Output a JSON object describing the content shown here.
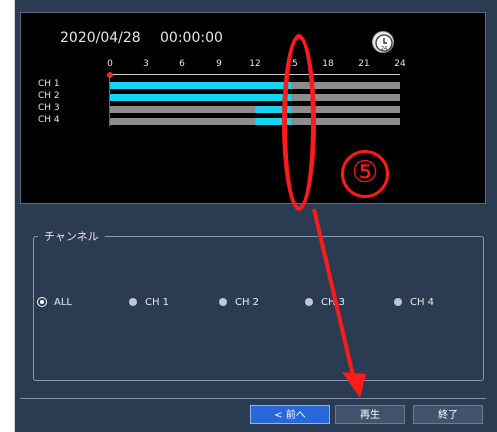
{
  "timeline": {
    "date": "2020/04/28",
    "time": "00:00:00",
    "ticks": [
      "0",
      "3",
      "6",
      "9",
      "12",
      "15",
      "18",
      "21",
      "24"
    ],
    "channels": [
      {
        "label": "CH 1",
        "segments": [
          [
            0,
            15
          ]
        ]
      },
      {
        "label": "CH 2",
        "segments": [
          [
            0,
            15
          ]
        ]
      },
      {
        "label": "CH 3",
        "segments": [
          [
            12,
            15
          ]
        ]
      },
      {
        "label": "CH 4",
        "segments": [
          [
            12,
            15
          ]
        ]
      }
    ],
    "clock_icon_label": "24"
  },
  "channel_panel": {
    "title": "チャンネル",
    "options": [
      "ALL",
      "CH 1",
      "CH 2",
      "CH 3",
      "CH 4"
    ],
    "selected": "ALL"
  },
  "buttons": {
    "prev": "< 前へ",
    "play": "再生",
    "end": "終了"
  },
  "annotation": {
    "label": "⑤",
    "color": "#ff1b1b"
  },
  "colors": {
    "accent": "#2767d8",
    "bar": "#17d3ef",
    "track": "#8d8d8d"
  }
}
